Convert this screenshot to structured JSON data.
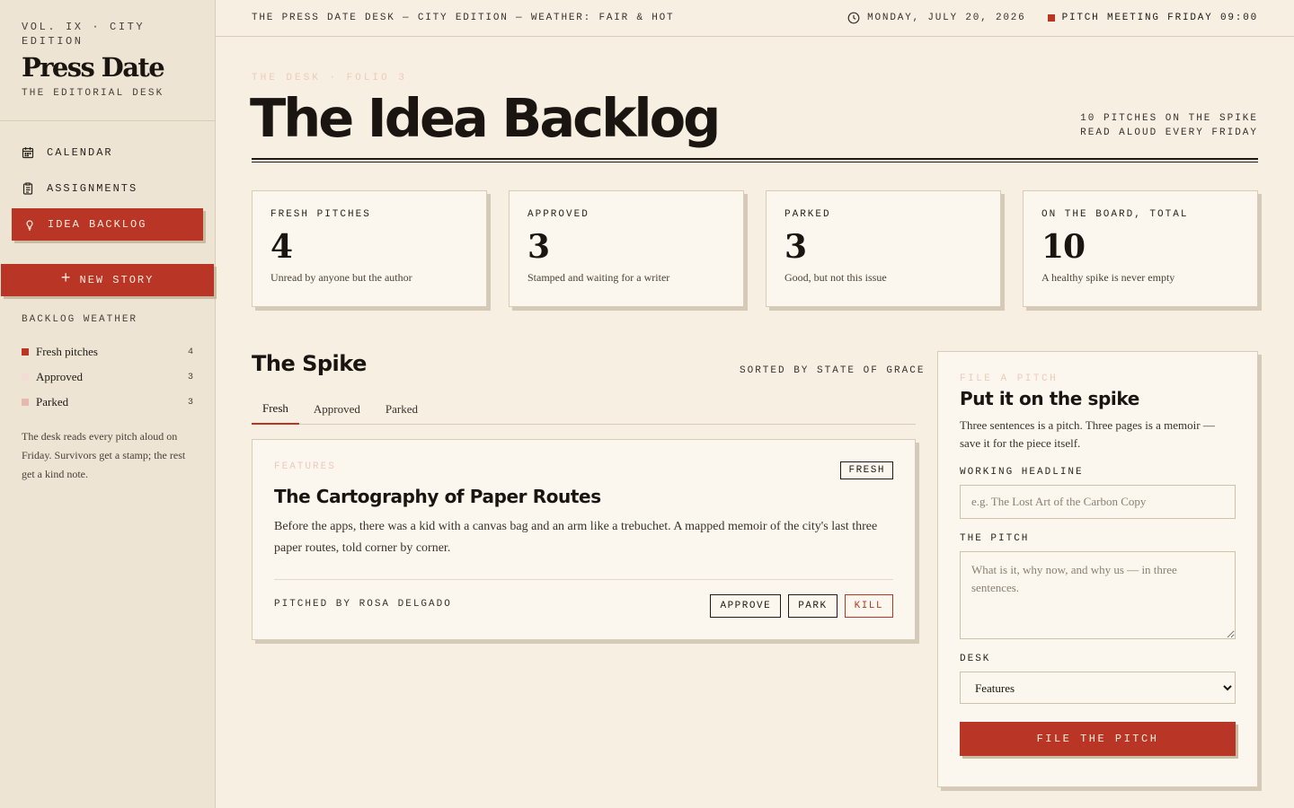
{
  "brand": {
    "volume": "Vol. IX · City Edition",
    "title": "Press Date",
    "subtitle": "The Editorial Desk"
  },
  "nav": {
    "items": [
      {
        "label": "Calendar",
        "icon": "calendar-icon"
      },
      {
        "label": "Assignments",
        "icon": "clipboard-icon"
      },
      {
        "label": "Idea Backlog",
        "icon": "lightbulb-icon",
        "active": true
      }
    ],
    "new_story": "New Story"
  },
  "weather": {
    "heading": "Backlog Weather",
    "rows": [
      {
        "label": "Fresh pitches",
        "count": "4",
        "color": "#b93526"
      },
      {
        "label": "Approved",
        "count": "3",
        "color": "#f3dcd4"
      },
      {
        "label": "Parked",
        "count": "3",
        "color": "#e6b8b0"
      }
    ],
    "note": "The desk reads every pitch aloud on Friday. Survivors get a stamp; the rest get a kind note."
  },
  "topbar": {
    "edition": "The Press Date Desk — City Edition — Weather: Fair & Hot",
    "date": "Monday, July 20, 2026",
    "meeting": "Pitch Meeting Friday 09:00"
  },
  "header": {
    "eyebrow": "The Desk · Folio 3",
    "title": "The Idea Backlog",
    "spike_count": "10 Pitches on the Spike",
    "read_aloud": "Read aloud every Friday"
  },
  "stats": [
    {
      "label": "Fresh Pitches",
      "value": "4",
      "desc": "Unread by anyone but the author"
    },
    {
      "label": "Approved",
      "value": "3",
      "desc": "Stamped and waiting for a writer"
    },
    {
      "label": "Parked",
      "value": "3",
      "desc": "Good, but not this issue"
    },
    {
      "label": "On the Board, Total",
      "value": "10",
      "desc": "A healthy spike is never empty"
    }
  ],
  "spike": {
    "title": "The Spike",
    "sorted": "Sorted by state of grace",
    "tabs": [
      "Fresh",
      "Approved",
      "Parked"
    ],
    "active_tab": "Fresh",
    "card": {
      "desk": "Features",
      "badge": "Fresh",
      "headline": "The Cartography of Paper Routes",
      "body": "Before the apps, there was a kid with a canvas bag and an arm like a trebuchet. A mapped memoir of the city's last three paper routes, told corner by corner.",
      "byline": "Pitched by Rosa Delgado",
      "actions": {
        "approve": "Approve",
        "park": "Park",
        "kill": "Kill"
      }
    }
  },
  "form": {
    "eyebrow": "File a Pitch",
    "title": "Put it on the spike",
    "intro": "Three sentences is a pitch. Three pages is a memoir — save it for the piece itself.",
    "headline_label": "Working Headline",
    "headline_placeholder": "e.g. The Lost Art of the Carbon Copy",
    "pitch_label": "The Pitch",
    "pitch_placeholder": "What is it, why now, and why us — in three sentences.",
    "desk_label": "Desk",
    "desk_value": "Features",
    "submit": "File the Pitch"
  },
  "colors": {
    "accent": "#b93526",
    "paper": "#f6efe2",
    "ink": "#1f1a15"
  }
}
